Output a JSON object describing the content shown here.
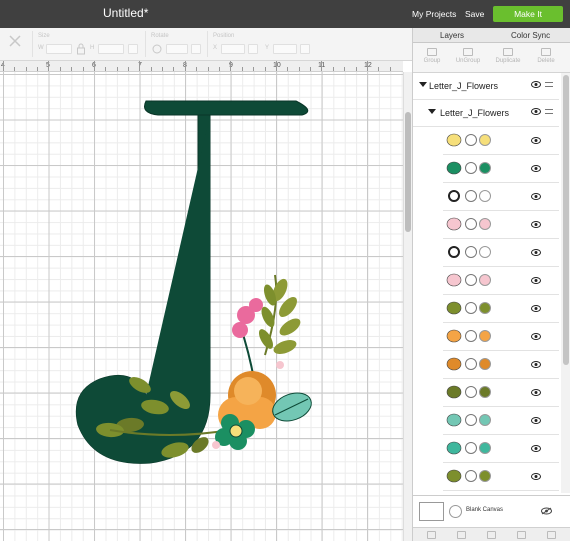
{
  "header": {
    "title": "Untitled*",
    "my_projects": "My Projects",
    "save": "Save",
    "make_it": "Make It",
    "make_it_color": "#6abf2e",
    "bar_color": "#404040"
  },
  "toolbar": {
    "size": "Size",
    "rotate": "Rotate",
    "position": "Position",
    "w_label": "W",
    "h_label": "H",
    "x_label": "X",
    "y_label": "Y"
  },
  "ruler": {
    "marks": [
      "4",
      "5",
      "6",
      "7",
      "8",
      "9",
      "10",
      "11",
      "12"
    ]
  },
  "panel": {
    "tabs": [
      "Layers",
      "Color Sync"
    ],
    "tools": [
      "Group",
      "UnGroup",
      "Duplicate",
      "Delete"
    ],
    "groups": [
      {
        "label": "Letter_J_Flowers"
      },
      {
        "label": "Letter_J_Flowers"
      }
    ],
    "layers": [
      {
        "icon": "yellow-circle-icon",
        "color": "#f6df7a"
      },
      {
        "icon": "green-flower-icon",
        "color": "#1b8f62"
      },
      {
        "icon": "white-ring-icon",
        "color": "#ffffff"
      },
      {
        "icon": "pink-flower-icon",
        "color": "#f6c6cf"
      },
      {
        "icon": "white-ring-icon",
        "color": "#ffffff"
      },
      {
        "icon": "pink-flower-icon",
        "color": "#f6c6cf"
      },
      {
        "icon": "olive-leaves-icon",
        "color": "#7d8f2d"
      },
      {
        "icon": "orange-flower-icon",
        "color": "#f4a445"
      },
      {
        "icon": "dark-orange-leaves-icon",
        "color": "#df8a2a"
      },
      {
        "icon": "olive-stem-icon",
        "color": "#6b7a28"
      },
      {
        "icon": "mint-leaf-icon",
        "color": "#73c7b4"
      },
      {
        "icon": "teal-leaf-icon",
        "color": "#3fb79d"
      },
      {
        "icon": "olive-sprig-icon",
        "color": "#7d8f2d"
      }
    ],
    "canvas_label": "Blank Canvas"
  }
}
